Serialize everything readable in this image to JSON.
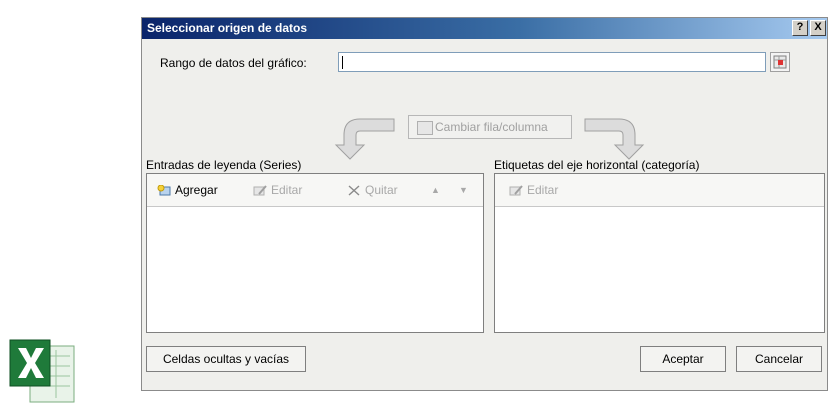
{
  "dialog": {
    "title": "Seleccionar origen de datos",
    "help_label": "?",
    "close_label": "X",
    "range_label": "Rango de datos del gráfico:",
    "range_value": "",
    "switch_label": "Cambiar fila/columna",
    "legend_label": "Entradas de leyenda (Series)",
    "axis_label": "Etiquetas del eje horizontal (categoría)",
    "legend_toolbar": {
      "add": "Agregar",
      "edit": "Editar",
      "remove": "Quitar",
      "up": "▲",
      "down": "▼"
    },
    "axis_toolbar": {
      "edit": "Editar"
    },
    "hidden_cells_button": "Celdas ocultas y vacías",
    "ok_button": "Aceptar",
    "cancel_button": "Cancelar"
  },
  "colors": {
    "title_bar_start": "#0a246a",
    "title_bar_end": "#a6caf0",
    "dialog_bg": "#efefec",
    "excel_green": "#1f7a3a"
  },
  "icons": [
    "excel-logo-icon",
    "range-select-icon",
    "switch-icon",
    "add-series-icon",
    "edit-icon",
    "remove-icon",
    "move-up-icon",
    "move-down-icon"
  ]
}
